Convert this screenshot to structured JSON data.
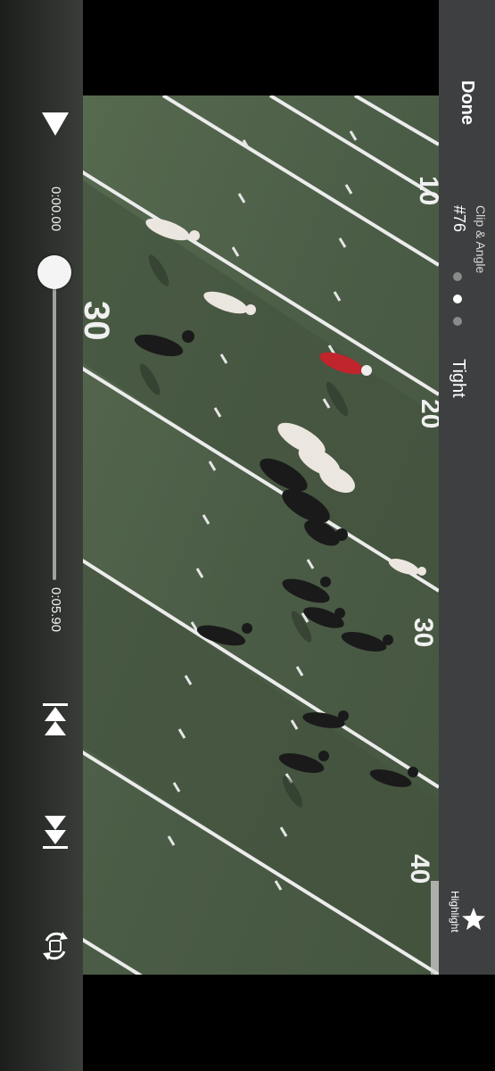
{
  "player": {
    "current_time": "0:00.00",
    "end_time": "0:05.90",
    "progress_fraction": 0.0
  },
  "header": {
    "done_label": "Done",
    "clip_angle_label": "Clip & Angle",
    "camera_number": "#76",
    "angle_name": "Tight",
    "angle_page_count": 3,
    "angle_page_active": 1
  },
  "actions": {
    "highlight_label": "Highlight"
  },
  "field": {
    "yard_numbers": [
      "30",
      "20",
      "10",
      "30",
      "40"
    ]
  },
  "icons": {
    "play": "play-icon",
    "previous_clip": "previous-clip-icon",
    "next_clip": "next-clip-icon",
    "rotate": "rotate-icon",
    "highlight": "star-icon"
  },
  "colors": {
    "field_green": "#4f6049",
    "field_dark": "#3f4d3b",
    "line_white": "#f1f1f1",
    "panel_gray": "#3e3f40",
    "team_dark": "#1a1a1a",
    "team_white": "#ece6e1",
    "jersey_red": "#c0252b"
  }
}
